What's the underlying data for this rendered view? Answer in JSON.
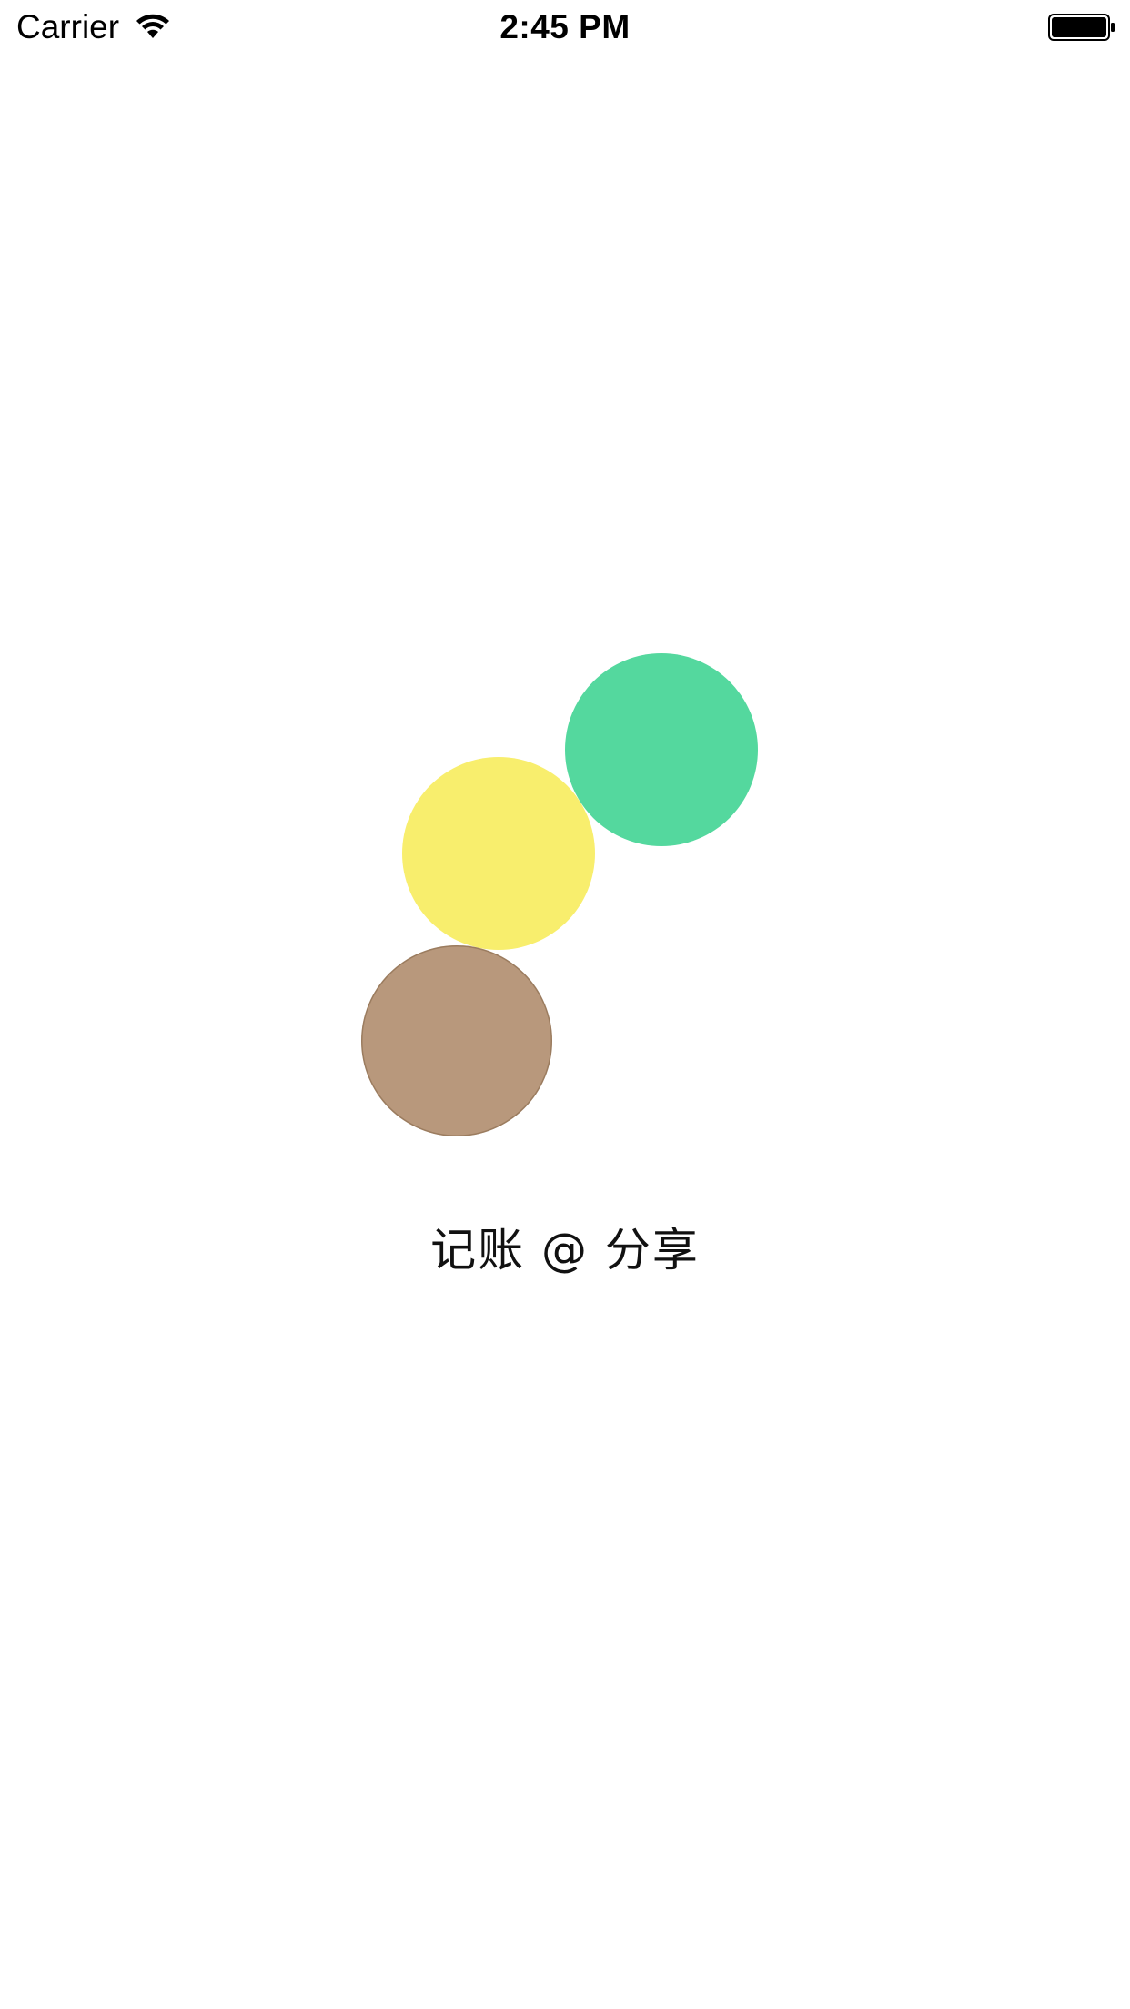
{
  "status_bar": {
    "carrier": "Carrier",
    "time": "2:45 PM",
    "wifi_icon": "wifi-icon",
    "battery_icon": "battery-full-icon",
    "battery_level": 1.0
  },
  "loader": {
    "circles": [
      {
        "name": "green",
        "color": "#54D89E"
      },
      {
        "name": "yellow",
        "color": "#F8EE6D"
      },
      {
        "name": "brown",
        "color": "#B8987C"
      }
    ]
  },
  "app": {
    "title": "记账 @ 分享"
  }
}
